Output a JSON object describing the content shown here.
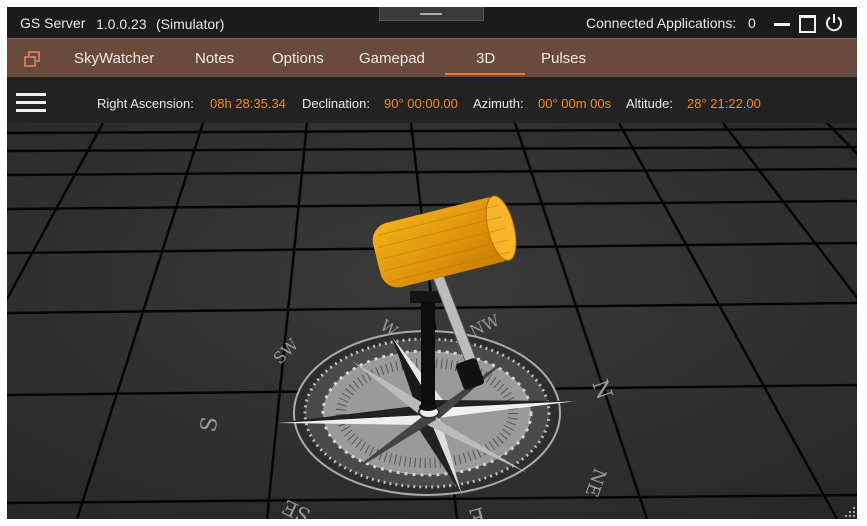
{
  "titlebar": {
    "app_name": "GS Server",
    "version": "1.0.0.23",
    "mode": "(Simulator)",
    "connected_label": "Connected Applications:",
    "connected_count": "0",
    "minimize_icon": "minimize-icon",
    "maximize_icon": "maximize-icon",
    "power_icon": "power-icon"
  },
  "tabs": [
    {
      "label": "SkyWatcher"
    },
    {
      "label": "Notes"
    },
    {
      "label": "Options"
    },
    {
      "label": "Gamepad"
    },
    {
      "label": "3D",
      "active": true
    },
    {
      "label": "Pulses"
    }
  ],
  "infobar": {
    "ra_label": "Right Ascension:",
    "ra_value": "08h 28:35.34",
    "dec_label": "Declination:",
    "dec_value": "90° 00:00.00",
    "az_label": "Azimuth:",
    "az_value": "00° 00m 00s",
    "alt_label": "Altitude:",
    "alt_value": "28° 21:22.00"
  },
  "compass": {
    "N": "N",
    "NE": "NE",
    "E": "E",
    "SE": "SE",
    "S": "S",
    "SW": "SW",
    "W": "W",
    "NW": "NW"
  },
  "colors": {
    "accent": "#ef7b2b",
    "tab_bar": "#6a4a3d",
    "telescope": "#f0a000",
    "value_text": "#f08a2c"
  }
}
